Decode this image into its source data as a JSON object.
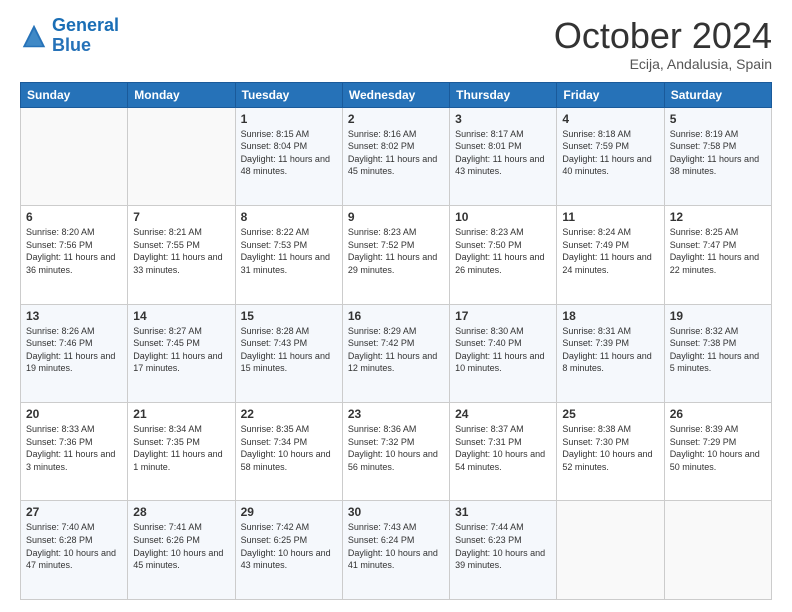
{
  "header": {
    "logo_general": "General",
    "logo_blue": "Blue",
    "month_title": "October 2024",
    "location": "Ecija, Andalusia, Spain"
  },
  "weekdays": [
    "Sunday",
    "Monday",
    "Tuesday",
    "Wednesday",
    "Thursday",
    "Friday",
    "Saturday"
  ],
  "weeks": [
    [
      {
        "day": "",
        "info": ""
      },
      {
        "day": "",
        "info": ""
      },
      {
        "day": "1",
        "info": "Sunrise: 8:15 AM\nSunset: 8:04 PM\nDaylight: 11 hours and 48 minutes."
      },
      {
        "day": "2",
        "info": "Sunrise: 8:16 AM\nSunset: 8:02 PM\nDaylight: 11 hours and 45 minutes."
      },
      {
        "day": "3",
        "info": "Sunrise: 8:17 AM\nSunset: 8:01 PM\nDaylight: 11 hours and 43 minutes."
      },
      {
        "day": "4",
        "info": "Sunrise: 8:18 AM\nSunset: 7:59 PM\nDaylight: 11 hours and 40 minutes."
      },
      {
        "day": "5",
        "info": "Sunrise: 8:19 AM\nSunset: 7:58 PM\nDaylight: 11 hours and 38 minutes."
      }
    ],
    [
      {
        "day": "6",
        "info": "Sunrise: 8:20 AM\nSunset: 7:56 PM\nDaylight: 11 hours and 36 minutes."
      },
      {
        "day": "7",
        "info": "Sunrise: 8:21 AM\nSunset: 7:55 PM\nDaylight: 11 hours and 33 minutes."
      },
      {
        "day": "8",
        "info": "Sunrise: 8:22 AM\nSunset: 7:53 PM\nDaylight: 11 hours and 31 minutes."
      },
      {
        "day": "9",
        "info": "Sunrise: 8:23 AM\nSunset: 7:52 PM\nDaylight: 11 hours and 29 minutes."
      },
      {
        "day": "10",
        "info": "Sunrise: 8:23 AM\nSunset: 7:50 PM\nDaylight: 11 hours and 26 minutes."
      },
      {
        "day": "11",
        "info": "Sunrise: 8:24 AM\nSunset: 7:49 PM\nDaylight: 11 hours and 24 minutes."
      },
      {
        "day": "12",
        "info": "Sunrise: 8:25 AM\nSunset: 7:47 PM\nDaylight: 11 hours and 22 minutes."
      }
    ],
    [
      {
        "day": "13",
        "info": "Sunrise: 8:26 AM\nSunset: 7:46 PM\nDaylight: 11 hours and 19 minutes."
      },
      {
        "day": "14",
        "info": "Sunrise: 8:27 AM\nSunset: 7:45 PM\nDaylight: 11 hours and 17 minutes."
      },
      {
        "day": "15",
        "info": "Sunrise: 8:28 AM\nSunset: 7:43 PM\nDaylight: 11 hours and 15 minutes."
      },
      {
        "day": "16",
        "info": "Sunrise: 8:29 AM\nSunset: 7:42 PM\nDaylight: 11 hours and 12 minutes."
      },
      {
        "day": "17",
        "info": "Sunrise: 8:30 AM\nSunset: 7:40 PM\nDaylight: 11 hours and 10 minutes."
      },
      {
        "day": "18",
        "info": "Sunrise: 8:31 AM\nSunset: 7:39 PM\nDaylight: 11 hours and 8 minutes."
      },
      {
        "day": "19",
        "info": "Sunrise: 8:32 AM\nSunset: 7:38 PM\nDaylight: 11 hours and 5 minutes."
      }
    ],
    [
      {
        "day": "20",
        "info": "Sunrise: 8:33 AM\nSunset: 7:36 PM\nDaylight: 11 hours and 3 minutes."
      },
      {
        "day": "21",
        "info": "Sunrise: 8:34 AM\nSunset: 7:35 PM\nDaylight: 11 hours and 1 minute."
      },
      {
        "day": "22",
        "info": "Sunrise: 8:35 AM\nSunset: 7:34 PM\nDaylight: 10 hours and 58 minutes."
      },
      {
        "day": "23",
        "info": "Sunrise: 8:36 AM\nSunset: 7:32 PM\nDaylight: 10 hours and 56 minutes."
      },
      {
        "day": "24",
        "info": "Sunrise: 8:37 AM\nSunset: 7:31 PM\nDaylight: 10 hours and 54 minutes."
      },
      {
        "day": "25",
        "info": "Sunrise: 8:38 AM\nSunset: 7:30 PM\nDaylight: 10 hours and 52 minutes."
      },
      {
        "day": "26",
        "info": "Sunrise: 8:39 AM\nSunset: 7:29 PM\nDaylight: 10 hours and 50 minutes."
      }
    ],
    [
      {
        "day": "27",
        "info": "Sunrise: 7:40 AM\nSunset: 6:28 PM\nDaylight: 10 hours and 47 minutes."
      },
      {
        "day": "28",
        "info": "Sunrise: 7:41 AM\nSunset: 6:26 PM\nDaylight: 10 hours and 45 minutes."
      },
      {
        "day": "29",
        "info": "Sunrise: 7:42 AM\nSunset: 6:25 PM\nDaylight: 10 hours and 43 minutes."
      },
      {
        "day": "30",
        "info": "Sunrise: 7:43 AM\nSunset: 6:24 PM\nDaylight: 10 hours and 41 minutes."
      },
      {
        "day": "31",
        "info": "Sunrise: 7:44 AM\nSunset: 6:23 PM\nDaylight: 10 hours and 39 minutes."
      },
      {
        "day": "",
        "info": ""
      },
      {
        "day": "",
        "info": ""
      }
    ]
  ]
}
